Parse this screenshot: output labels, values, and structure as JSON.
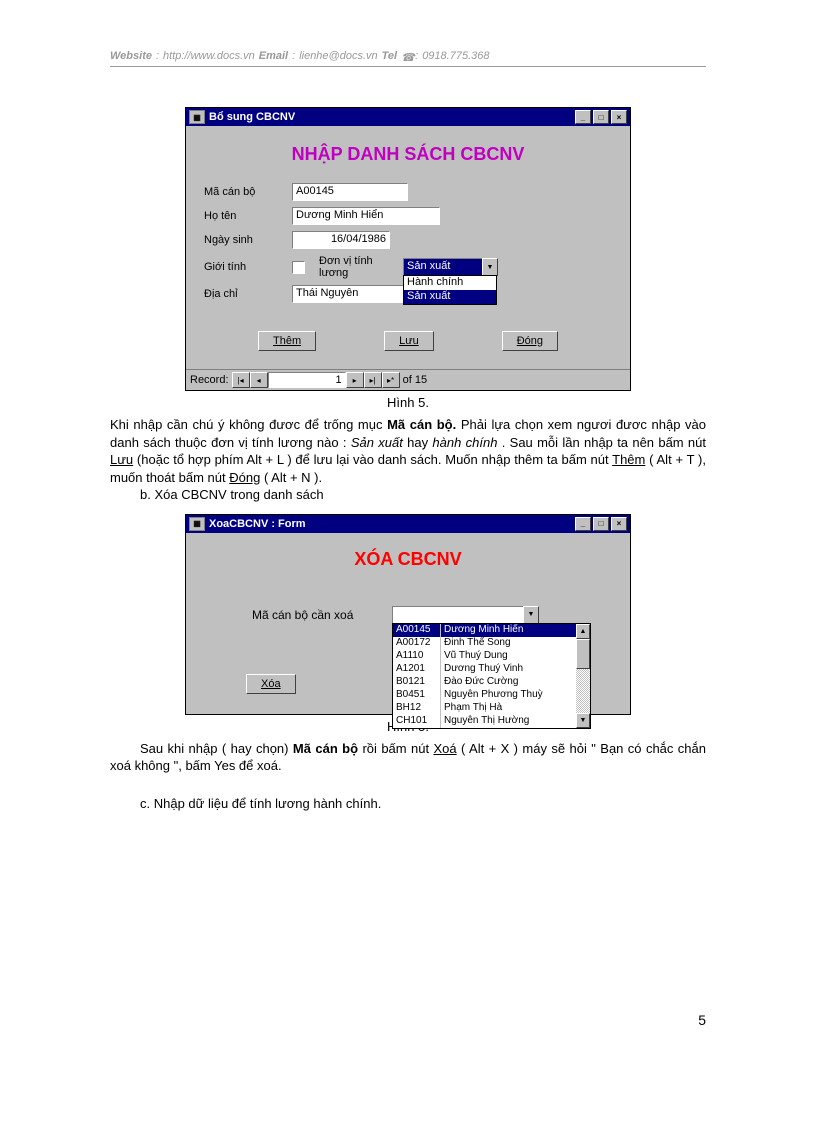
{
  "header": {
    "website_lbl": "Website",
    "website_sep": ":",
    "website_val": "http://www.docs.vn",
    "email_lbl": "Email",
    "email_sep": ":",
    "email_val": "lienhe@docs.vn",
    "tel_lbl": "Tel",
    "tel_sep": ":",
    "tel_val": "0918.775.368"
  },
  "form1": {
    "title": "Bổ sung CBCNV",
    "heading": "NHẬP DANH SÁCH CBCNV",
    "labels": {
      "ma": "Mã cán bộ",
      "hoten": "Họ tên",
      "ngaysinh": "Ngày sinh",
      "gioitinh": "Giới tính",
      "donvi": "Đơn vị tính lương",
      "diachi": "Địa chỉ"
    },
    "values": {
      "ma": "A00145",
      "hoten": "Dương Minh Hiển",
      "ngaysinh": "16/04/1986",
      "donvi_selected": "Sản xuất",
      "diachi": "Thái Nguyên"
    },
    "dropdown_options": [
      "Hành chính",
      "Sản xuất"
    ],
    "buttons": {
      "them": "Thêm",
      "luu": "Lưu",
      "dong": "Đóng"
    },
    "record": {
      "label": "Record:",
      "current": "1",
      "of": "of  15"
    }
  },
  "caption1": "Hình 5.",
  "para1": {
    "t1": "Khi nhập cần chú ý không đươc để trống mục ",
    "b1": "Mã cán bộ.",
    "t2": " Phải lựa chọn xem ngươi đươc nhập vào danh sách thuộc đơn vị tính lương nào : ",
    "i1": "Sản xuất",
    "t3": " hay ",
    "i2": "hành chính",
    "t4": " . Sau mỗi lần nhập ta nên bấm nút ",
    "u1": "Lưu",
    "t5": " (hoặc tổ hợp phím Alt + L ) để lưu lại vào danh sách. Muốn nhập thêm ta bấm nút ",
    "u2": "Thêm",
    "t6": " ( Alt + T ), muốn thoát bấm nút ",
    "u3": "Đóng",
    "t7": " ( Alt + N )."
  },
  "para_b": "b.  Xóa CBCNV trong danh sách",
  "form2": {
    "title": "XoaCBCNV : Form",
    "heading": "XÓA CBCNV",
    "label": "Mã cán bộ cần xoá",
    "btn": "Xóa",
    "employees": [
      {
        "id": "A00145",
        "name": "Dương Minh Hiển"
      },
      {
        "id": "A00172",
        "name": "Đinh Thế Song"
      },
      {
        "id": "A1110",
        "name": "Vũ Thuý Dung"
      },
      {
        "id": "A1201",
        "name": "Dương Thuý Vinh"
      },
      {
        "id": "B0121",
        "name": "Đào Đức Cường"
      },
      {
        "id": "B0451",
        "name": "Nguyễn Phương Thuỳ"
      },
      {
        "id": "BH12",
        "name": "Phạm Thị Hà"
      },
      {
        "id": "CH101",
        "name": "Nguyễn Thị Hường"
      }
    ]
  },
  "caption2": "Hình 5.",
  "para2": {
    "t1": "Sau khi nhập ( hay chọn) ",
    "b1": "Mã cán bộ",
    "t2": " rồi bấm nút ",
    "u1": "Xoá",
    "t3": " ( Alt + X ) máy sẽ hỏi \" Bạn có chắc chắn xoá không \", bấm Yes để xoá."
  },
  "para_c": "c. Nhập dữ liệu để tính lương hành chính.",
  "page_number": "5"
}
